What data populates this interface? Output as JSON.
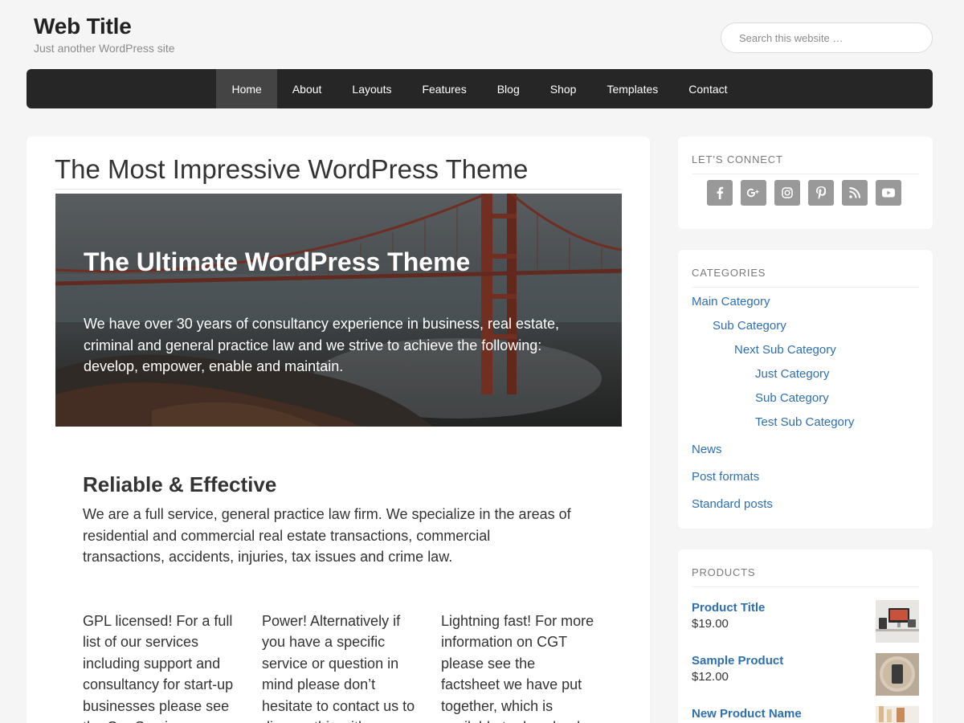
{
  "header": {
    "site_title": "Web Title",
    "site_description": "Just another WordPress site",
    "search_placeholder": "Search this website …"
  },
  "nav": {
    "items": [
      {
        "label": "Home",
        "active": true
      },
      {
        "label": "About"
      },
      {
        "label": "Layouts"
      },
      {
        "label": "Features"
      },
      {
        "label": "Blog"
      },
      {
        "label": "Shop"
      },
      {
        "label": "Templates"
      },
      {
        "label": "Contact"
      }
    ]
  },
  "main": {
    "title": "The Most Impressive WordPress Theme",
    "hero": {
      "heading": "The Ultimate WordPress Theme",
      "text": "We have over 30 years of consultancy experience in business, real estate, criminal and general practice law and we strive to achieve the following: develop, empower, enable and maintain."
    },
    "section_heading": "Reliable & Effective",
    "section_text": "We are a full service, general practice law firm. We specialize in the areas of residential and commercial real estate transactions, commercial transactions, accidents, injuries, tax issues and crime law.",
    "columns": [
      "GPL licensed! For a full list of our services including support and consultancy for start-up businesses please see the Our Services page.",
      "Power! Alternatively if you have a specific service or question in mind please don’t hesitate to contact us to discuss this with us today.",
      "Lightning fast! For more information on CGT please see the factsheet we have put together, which is available to download below."
    ]
  },
  "sidebar": {
    "connect": {
      "title": "LET’S CONNECT",
      "icons": [
        "facebook-icon",
        "google-plus-icon",
        "instagram-icon",
        "pinterest-icon",
        "rss-icon",
        "youtube-icon"
      ]
    },
    "categories": {
      "title": "CATEGORIES",
      "items": [
        {
          "label": "Main Category",
          "level": 0
        },
        {
          "label": "Sub Category",
          "level": 1
        },
        {
          "label": "Next Sub Category",
          "level": 2
        },
        {
          "label": "Just Category",
          "level": 3
        },
        {
          "label": "Sub Category",
          "level": 3
        },
        {
          "label": "Test Sub Category",
          "level": 3
        },
        {
          "label": "News",
          "level": 0
        },
        {
          "label": "Post formats",
          "level": 0
        },
        {
          "label": "Standard posts",
          "level": 0
        }
      ]
    },
    "products": {
      "title": "PRODUCTS",
      "items": [
        {
          "name": "Product Title",
          "price": "$19.00"
        },
        {
          "name": "Sample Product",
          "price": "$12.00"
        },
        {
          "name": "New Product Name",
          "price": ""
        }
      ]
    }
  },
  "colors": {
    "nav_bg": "#262626",
    "nav_active": "#444444",
    "link": "#2e6fb0",
    "social_bg": "#999999"
  }
}
